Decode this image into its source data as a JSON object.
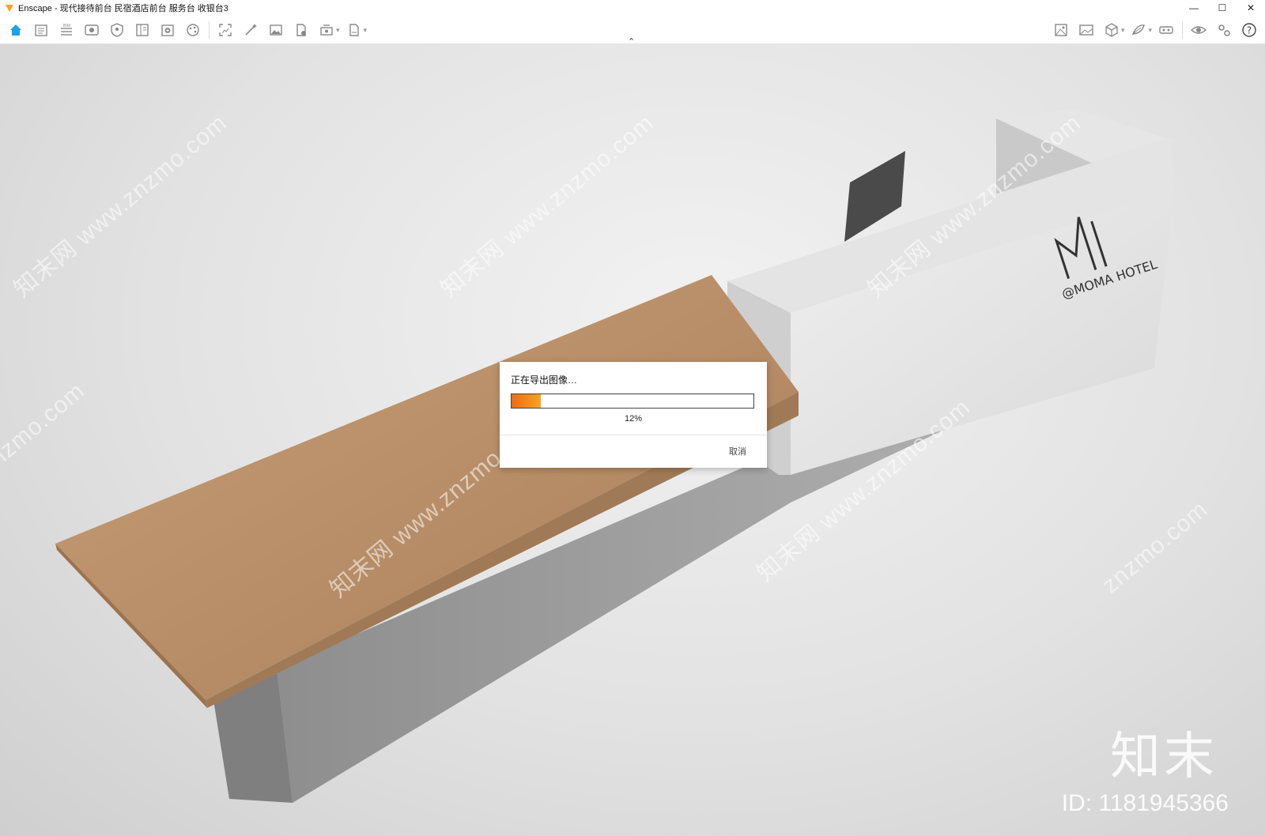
{
  "window": {
    "title": "Enscape - 现代接待前台 民宿酒店前台 服务台 收银台3",
    "controls": {
      "minimize": "—",
      "maximize": "☐",
      "close": "✕"
    }
  },
  "toolbar": {
    "left_icons": [
      "home-icon",
      "sheet-icon",
      "bim-icon",
      "eye-view-icon",
      "shield-icon",
      "book-icon",
      "add-view-icon",
      "palette-icon",
      "capture-icon",
      "magic-icon",
      "image-icon",
      "export-file-icon",
      "batch-render-icon",
      "export-doc-icon"
    ],
    "right_icons": [
      "asset-library-icon",
      "gallery-icon",
      "cube-icon",
      "material-icon",
      "vr-headset-icon",
      "visibility-icon",
      "settings-icon",
      "help-icon"
    ],
    "collapse_glyph": "⌃",
    "help_glyph": "?"
  },
  "dialog": {
    "title": "正在导出图像…",
    "progress": 0.12,
    "progress_text": "12%",
    "cancel_label": "取消",
    "progress_colors": [
      "#f06a12",
      "#f7a51e"
    ]
  },
  "scene": {
    "logo_text": "@MOMA HOTEL",
    "watermark_text": "知末网 www.znzmo.com",
    "watermark_short": "znzmo.com",
    "brand": "知末",
    "brand_id": "ID: 1181945366"
  },
  "colors": {
    "accent": "#1aa3e8",
    "wood": "#b98e66",
    "marble": "#9a9a9a"
  }
}
